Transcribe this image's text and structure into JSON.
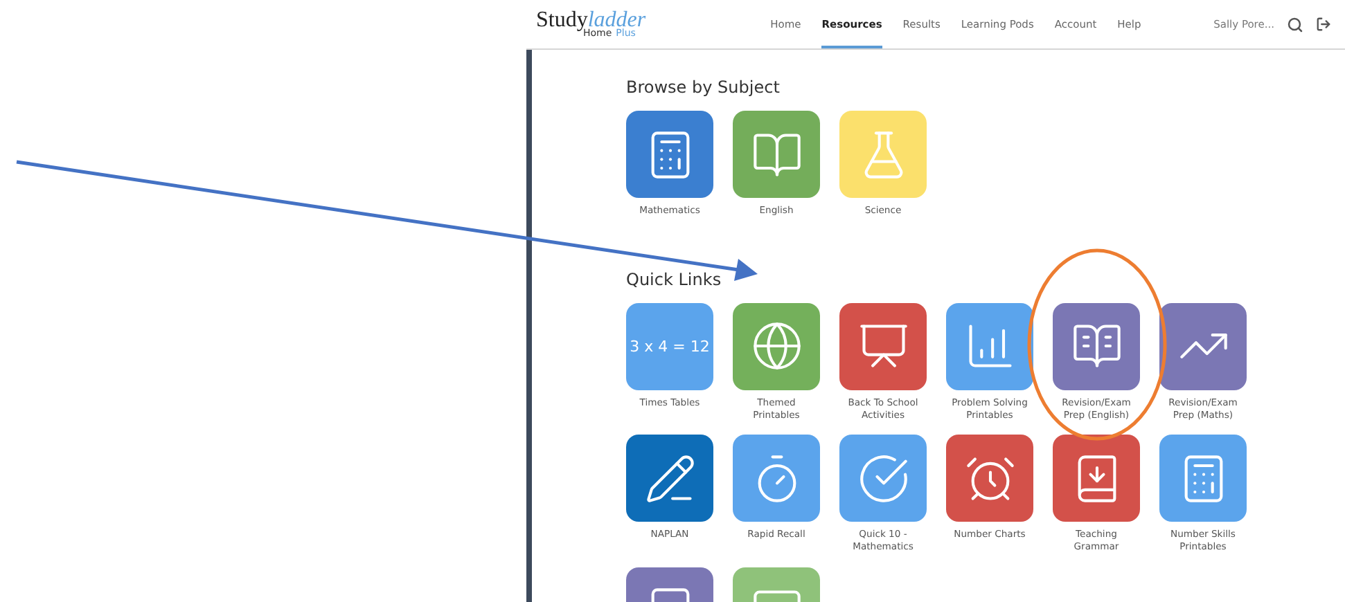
{
  "logo": {
    "word": "Study",
    "accent": "ladder",
    "sub": "Home",
    "sub_accent": "Plus"
  },
  "nav": [
    {
      "label": "Home",
      "selected": false
    },
    {
      "label": "Resources",
      "selected": true
    },
    {
      "label": "Results",
      "selected": false
    },
    {
      "label": "Learning Pods",
      "selected": false
    },
    {
      "label": "Account",
      "selected": false
    },
    {
      "label": "Help",
      "selected": false
    }
  ],
  "user": "Sally Pore...",
  "sections": [
    {
      "title": "Browse by Subject",
      "tiles": [
        {
          "label": "Mathematics",
          "color": "#3b7fd0"
        },
        {
          "label": "English",
          "color": "#74ad5a"
        },
        {
          "label": "Science",
          "color": "#fbe06c"
        }
      ]
    },
    {
      "title": "Quick Links",
      "tiles": [
        {
          "label": "Times Tables",
          "color": "#5ba4ec",
          "tile_text": "3 x 4 = 12"
        },
        {
          "label": "Themed Printables",
          "color": "#74b05b"
        },
        {
          "label": "Back To School Activities",
          "color": "#d3514a"
        },
        {
          "label": "Problem Solving Printables",
          "color": "#5ba4ec"
        },
        {
          "label": "Revision/Exam Prep (English)",
          "color": "#7b77b4"
        },
        {
          "label": "Revision/Exam Prep (Maths)",
          "color": "#7b77b4"
        },
        {
          "label": "NAPLAN",
          "color": "#0e6db7"
        },
        {
          "label": "Rapid Recall",
          "color": "#5ba4ec"
        },
        {
          "label": "Quick 10 - Mathematics",
          "color": "#5ba4ec"
        },
        {
          "label": "Number Charts",
          "color": "#d3514a"
        },
        {
          "label": "Teaching Grammar",
          "color": "#d3514a"
        },
        {
          "label": "Number Skills Printables",
          "color": "#5ba4ec"
        },
        {
          "color": "#7b77b4"
        },
        {
          "color": "#8fc27a"
        }
      ]
    }
  ]
}
